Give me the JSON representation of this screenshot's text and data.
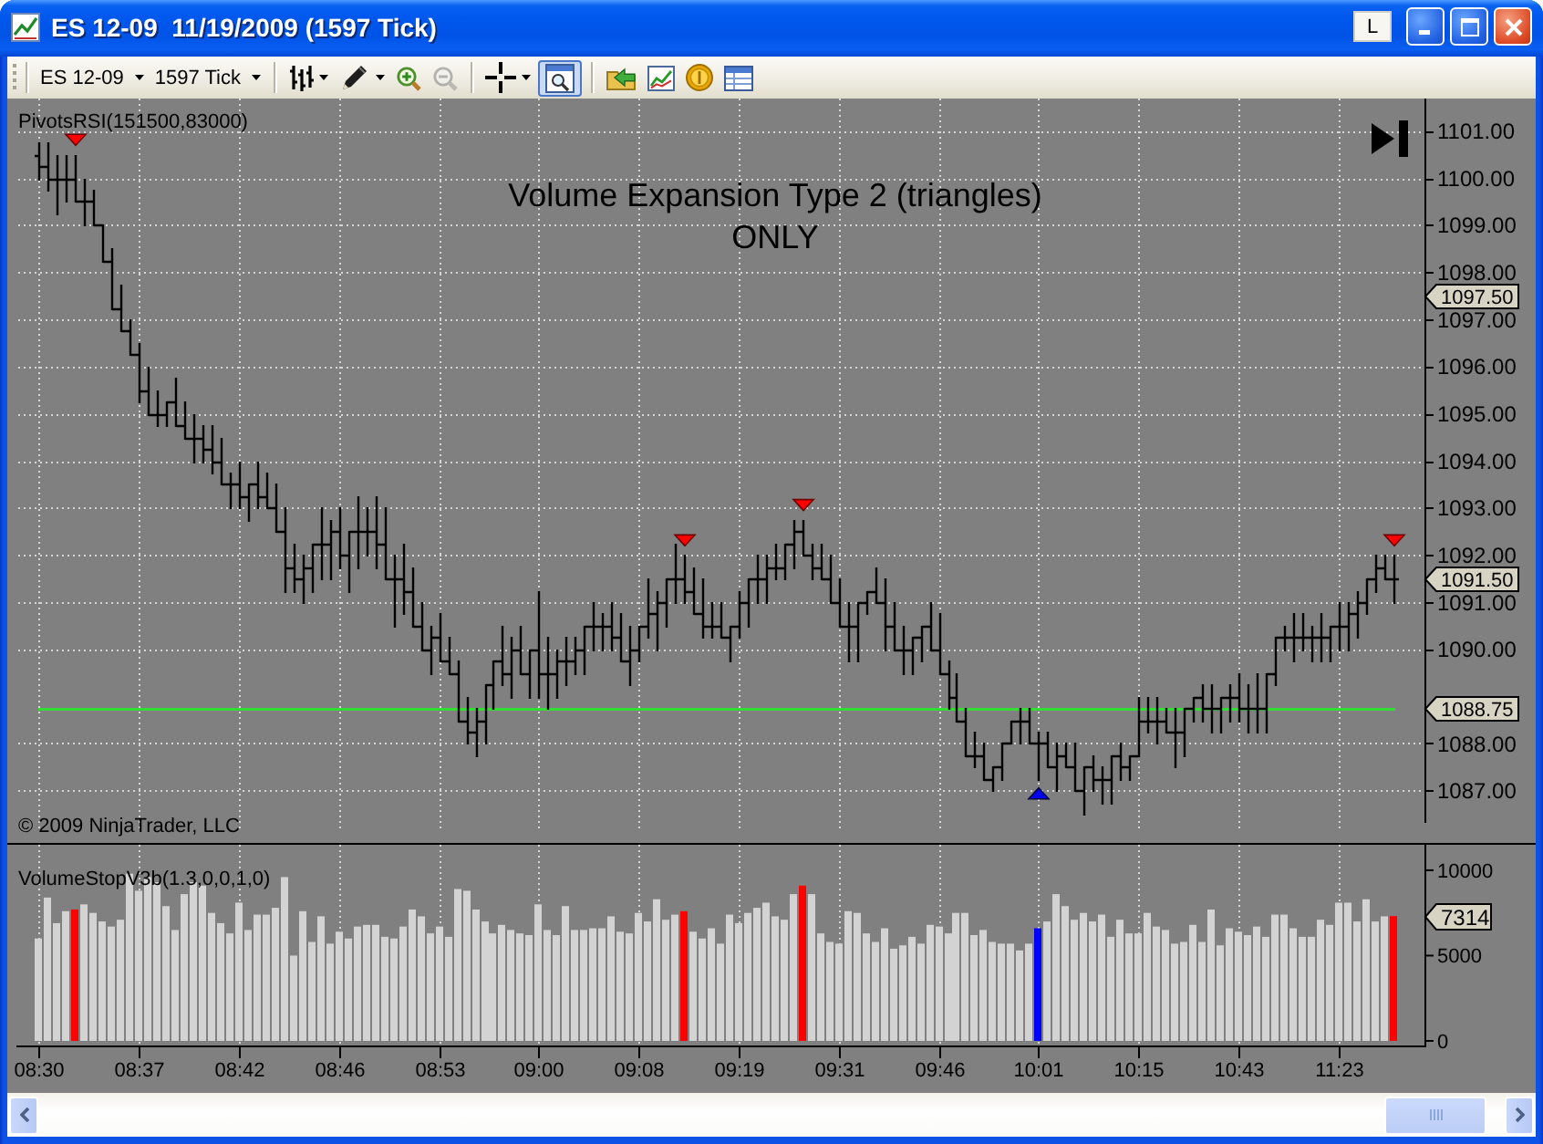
{
  "window": {
    "title": "ES 12-09  11/19/2009 (1597 Tick)",
    "title_button": "L"
  },
  "toolbar": {
    "dropdowns": [
      {
        "label": "ES 12-09"
      },
      {
        "label": "1597 Tick"
      }
    ],
    "groups": [
      {
        "tools": [
          {
            "kind": "bar_style",
            "selected": false,
            "disabled": false
          },
          {
            "kind": "draw",
            "selected": false,
            "disabled": false
          },
          {
            "kind": "zoom_in",
            "selected": false,
            "disabled": false
          },
          {
            "kind": "zoom_out",
            "selected": false,
            "disabled": true
          }
        ]
      },
      {
        "tools": [
          {
            "kind": "crosshair",
            "selected": false,
            "disabled": false
          },
          {
            "kind": "data_box",
            "selected": true,
            "disabled": false
          }
        ]
      },
      {
        "tools": [
          {
            "kind": "open",
            "selected": false,
            "disabled": false
          },
          {
            "kind": "chart",
            "selected": false,
            "disabled": false
          },
          {
            "kind": "coin",
            "selected": false,
            "disabled": false
          },
          {
            "kind": "table",
            "selected": false,
            "disabled": false
          }
        ]
      }
    ]
  },
  "chart": {
    "price_panel": {
      "indicator_label": "PivotsRSI(151500,83000)",
      "note": "Volume Expansion Type 2 (triangles)\nONLY",
      "copyright": "© 2009 NinjaTrader, LLC",
      "axis_labels": [
        "1101.00",
        "1100.00",
        "1099.00",
        "1098.00",
        "1097.00",
        "1096.00",
        "1095.00",
        "1094.00",
        "1093.00",
        "1092.00",
        "1091.00",
        "1090.00",
        "1088.00",
        "1087.00"
      ],
      "markers": [
        {
          "label": "1097.50",
          "line": false
        },
        {
          "label": "1091.50",
          "line": false
        },
        {
          "label": "1088.75",
          "line": true
        }
      ]
    },
    "volume_panel": {
      "indicator_label": "VolumeStopV3b(1.3,0,0,1,0)",
      "last_value_marker": "7314",
      "chart_data": {
        "type": "bar",
        "ylim": [
          0,
          11600
        ],
        "yticks": [
          0,
          5000,
          10000
        ],
        "categories": [
          null,
          null,
          "08:30",
          null,
          null,
          null,
          null,
          null,
          null,
          null,
          null,
          null,
          null,
          "08:37",
          null,
          null,
          null,
          null,
          null,
          null,
          null,
          null,
          null,
          null,
          "08:42",
          null,
          null,
          null,
          null,
          null,
          null,
          null,
          null,
          null,
          null,
          "08:46",
          null,
          null,
          null,
          null,
          null,
          null,
          null,
          null,
          null,
          null,
          "08:53",
          null,
          null,
          null,
          null,
          null,
          null,
          null,
          null,
          null,
          null,
          "09:00",
          null,
          null,
          null,
          null,
          null,
          null,
          null,
          null,
          null,
          null,
          "09:08",
          null,
          null,
          null,
          null,
          null,
          null,
          null,
          null,
          null,
          null,
          "09:19",
          null,
          null,
          null,
          null,
          null,
          null,
          null,
          null,
          null,
          null,
          "09:31",
          null,
          null,
          null,
          null,
          null,
          null,
          null,
          null,
          null,
          null,
          "09:46",
          null,
          null,
          null,
          null,
          null,
          null,
          null,
          null,
          null,
          null,
          "10:01",
          null,
          null,
          null,
          null,
          null,
          null,
          null,
          null,
          null,
          null,
          "10:15",
          null,
          null,
          null,
          null,
          null,
          null,
          null,
          null,
          null,
          null,
          "10:43",
          null,
          null,
          null,
          null,
          null,
          null,
          null,
          null,
          null,
          null,
          "11:23",
          null,
          null,
          null,
          null,
          null,
          null,
          null,
          null,
          null
        ],
        "series": [
          {
            "color": "#d3d3d3",
            "values": [
              null,
              null,
              6000,
              8400,
              6900,
              7600,
              null,
              8000,
              7500,
              7000,
              6700,
              7100,
              9800,
              8800,
              9600,
              9300,
              7900,
              6500,
              8600,
              9300,
              9100,
              7500,
              6900,
              6300,
              8100,
              6500,
              7400,
              7400,
              7800,
              9600,
              5000,
              7600,
              5800,
              7300,
              5700,
              6400,
              6000,
              6700,
              6800,
              6800,
              6100,
              6000,
              6700,
              7700,
              7300,
              6300,
              6700,
              6100,
              8900,
              8800,
              7700,
              7000,
              6300,
              6800,
              6500,
              6300,
              6200,
              8000,
              6500,
              6200,
              7900,
              6500,
              6500,
              6600,
              6600,
              7300,
              6400,
              6300,
              7500,
              7000,
              8300,
              7100,
              7400,
              null,
              6400,
              6000,
              6600,
              5700,
              7400,
              6900,
              7500,
              7800,
              8100,
              7300,
              7100,
              8600,
              null,
              8600,
              6300,
              5800,
              5700,
              7600,
              7500,
              6300,
              5800,
              6600,
              5400,
              5600,
              6100,
              5700,
              6800,
              6700,
              6300,
              7500,
              7500,
              6200,
              6500,
              5800,
              5700,
              5700,
              5300,
              5700,
              null,
              7000,
              8600,
              7900,
              7100,
              7500,
              7000,
              7400,
              6100,
              7100,
              6300,
              6300,
              7500,
              6700,
              6500,
              5700,
              5800,
              6800,
              5800,
              7700,
              5600,
              6600,
              6400,
              6200,
              6700,
              6100,
              7400,
              7400,
              6600,
              6100,
              6100,
              7100,
              6800,
              8100,
              8100,
              7000,
              8300,
              7000,
              7300,
              null,
              null,
              null,
              null
            ]
          },
          {
            "color": "#ff0000",
            "values": [
              null,
              null,
              null,
              null,
              null,
              null,
              7700,
              null,
              null,
              null,
              null,
              null,
              null,
              null,
              null,
              null,
              null,
              null,
              null,
              null,
              null,
              null,
              null,
              null,
              null,
              null,
              null,
              null,
              null,
              null,
              null,
              null,
              null,
              null,
              null,
              null,
              null,
              null,
              null,
              null,
              null,
              null,
              null,
              null,
              null,
              null,
              null,
              null,
              null,
              null,
              null,
              null,
              null,
              null,
              null,
              null,
              null,
              null,
              null,
              null,
              null,
              null,
              null,
              null,
              null,
              null,
              null,
              null,
              null,
              null,
              null,
              null,
              null,
              7600,
              null,
              null,
              null,
              null,
              null,
              null,
              null,
              null,
              null,
              null,
              null,
              null,
              9100,
              null,
              null,
              null,
              null,
              null,
              null,
              null,
              null,
              null,
              null,
              null,
              null,
              null,
              null,
              null,
              null,
              null,
              null,
              null,
              null,
              null,
              null,
              null,
              null,
              null,
              null,
              null,
              null,
              null,
              null,
              null,
              null,
              null,
              null,
              null,
              null,
              null,
              null,
              null,
              null,
              null,
              null,
              null,
              null,
              null,
              null,
              null,
              null,
              null,
              null,
              null,
              null,
              null,
              null,
              null,
              null,
              null,
              null,
              null,
              null,
              null,
              null,
              null,
              null,
              7314,
              null,
              null,
              null
            ]
          },
          {
            "color": "#0000ff",
            "values": [
              null,
              null,
              null,
              null,
              null,
              null,
              null,
              null,
              null,
              null,
              null,
              null,
              null,
              null,
              null,
              null,
              null,
              null,
              null,
              null,
              null,
              null,
              null,
              null,
              null,
              null,
              null,
              null,
              null,
              null,
              null,
              null,
              null,
              null,
              null,
              null,
              null,
              null,
              null,
              null,
              null,
              null,
              null,
              null,
              null,
              null,
              null,
              null,
              null,
              null,
              null,
              null,
              null,
              null,
              null,
              null,
              null,
              null,
              null,
              null,
              null,
              null,
              null,
              null,
              null,
              null,
              null,
              null,
              null,
              null,
              null,
              null,
              null,
              null,
              null,
              null,
              null,
              null,
              null,
              null,
              null,
              null,
              null,
              null,
              null,
              null,
              null,
              null,
              null,
              null,
              null,
              null,
              null,
              null,
              null,
              null,
              null,
              null,
              null,
              null,
              null,
              null,
              null,
              null,
              null,
              null,
              null,
              null,
              null,
              null,
              null,
              null,
              6600,
              null,
              null,
              null,
              null,
              null,
              null,
              null,
              null,
              null,
              null,
              null,
              null,
              null,
              null,
              null,
              null,
              null,
              null,
              null,
              null,
              null,
              null,
              null,
              null,
              null,
              null,
              null,
              null,
              null,
              null,
              null,
              null,
              null,
              null,
              null,
              null,
              null,
              null,
              null,
              null,
              null,
              null
            ]
          }
        ]
      }
    }
  }
}
